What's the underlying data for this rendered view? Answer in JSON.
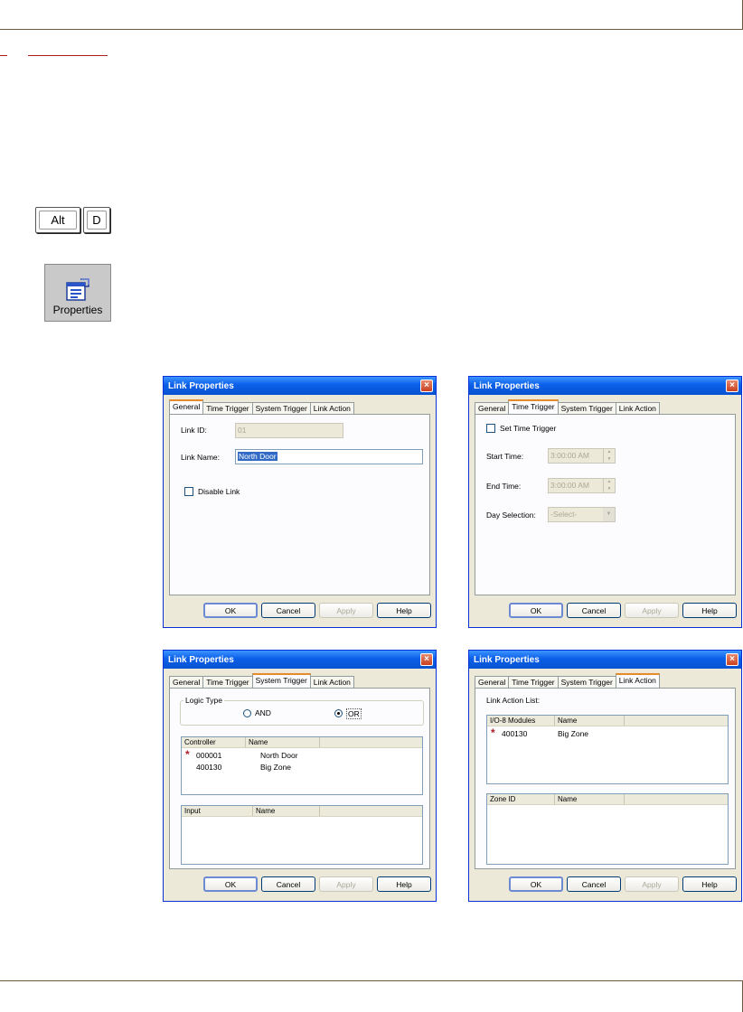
{
  "keys": [
    "Alt",
    "D"
  ],
  "properties_button": {
    "label": "Properties"
  },
  "dialog": {
    "title": "Link Properties",
    "close": "×",
    "tabs": [
      "General",
      "Time Trigger",
      "System Trigger",
      "Link Action"
    ],
    "buttons": {
      "ok": "OK",
      "cancel": "Cancel",
      "apply": "Apply",
      "help": "Help"
    }
  },
  "general": {
    "link_id_label": "Link ID:",
    "link_id_value": "01",
    "link_name_label": "Link Name:",
    "link_name_value": "North Door",
    "disable_link": "Disable Link"
  },
  "time_trigger": {
    "set_time_trigger": "Set Time Trigger",
    "start_label": "Start Time:",
    "start_value": "3:00:00 AM",
    "end_label": "End Time:",
    "end_value": "3:00:00 AM",
    "day_label": "Day Selection:",
    "day_value": "-Select-"
  },
  "system_trigger": {
    "logic_label": "Logic Type",
    "and_label": "AND",
    "or_label": "OR",
    "controller_cols": [
      "Controller",
      "Name"
    ],
    "controllers": [
      {
        "id": "000001",
        "name": "North Door"
      },
      {
        "id": "400130",
        "name": "Big Zone"
      }
    ],
    "input_cols": [
      "Input",
      "Name"
    ]
  },
  "link_action": {
    "list_label": "Link Action List:",
    "module_cols": [
      "I/O-8 Modules",
      "Name"
    ],
    "modules": [
      {
        "id": "400130",
        "name": "Big Zone"
      }
    ],
    "zone_cols": [
      "Zone ID",
      "Name"
    ]
  }
}
